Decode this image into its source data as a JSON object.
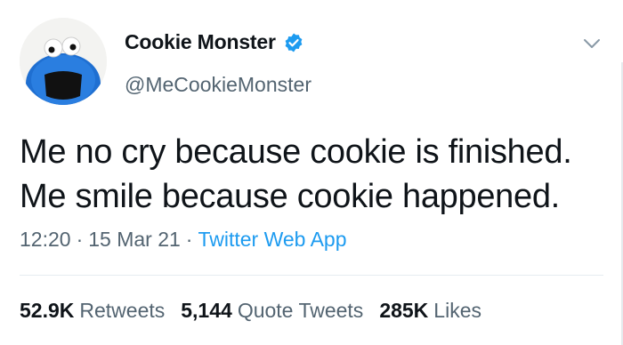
{
  "user": {
    "display_name": "Cookie Monster",
    "handle": "@MeCookieMonster",
    "verified": true,
    "avatar_icon": "cookie-monster-avatar"
  },
  "tweet": {
    "lines": [
      "Me no cry because cookie is finished.",
      "Me smile because cookie happened."
    ]
  },
  "meta": {
    "time": "12:20",
    "separator": "·",
    "date": "15 Mar 21",
    "source": "Twitter Web App"
  },
  "stats": {
    "retweets_count": "52.9K",
    "retweets_label": "Retweets",
    "quotes_count": "5,144",
    "quotes_label": "Quote Tweets",
    "likes_count": "285K",
    "likes_label": "Likes"
  },
  "colors": {
    "accent": "#1d9bf0",
    "secondary_text": "#536471",
    "primary_text": "#0f1419"
  },
  "icons": {
    "verified": "verified-badge-icon",
    "menu": "chevron-down-icon"
  }
}
